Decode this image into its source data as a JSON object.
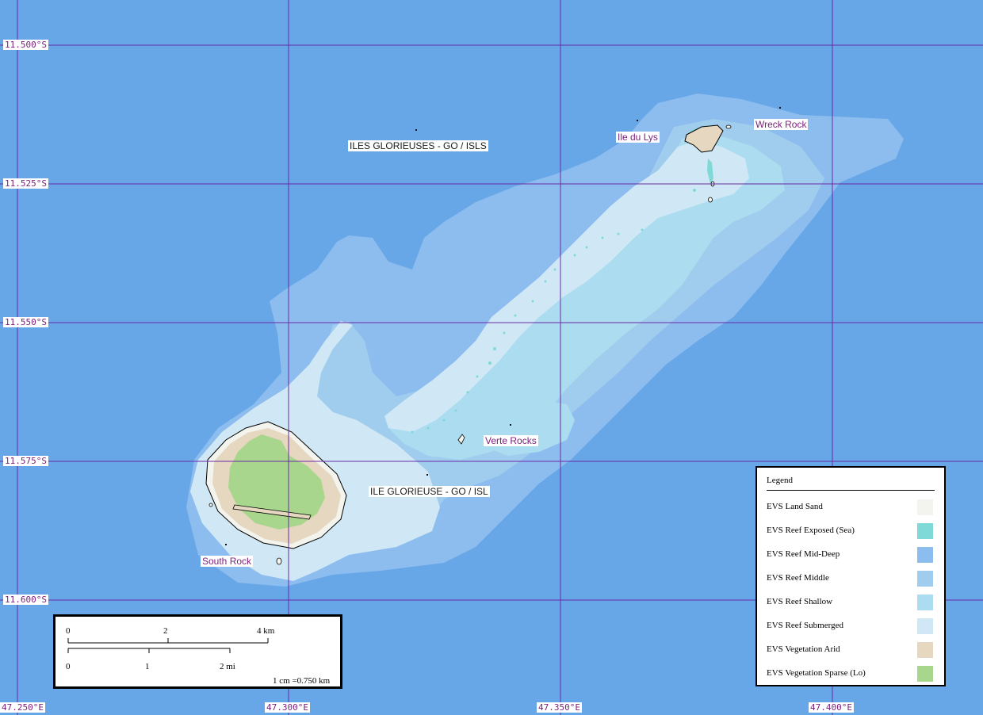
{
  "map": {
    "graticule": {
      "lat_labels": [
        "11.500°S",
        "11.525°S",
        "11.550°S",
        "11.575°S",
        "11.600°S"
      ],
      "lon_labels": [
        "47.250°E",
        "47.300°E",
        "47.350°E",
        "47.400°E"
      ]
    },
    "places": {
      "iles_glorieuses": "ILES GLORIEUSES - GO / ISLS",
      "ile_du_lys": "Ile du Lys",
      "wreck_rock": "Wreck Rock",
      "verte_rocks": "Verte Rocks",
      "ile_glorieuse": "ILE GLORIEUSE - GO / ISL",
      "south_rock": "South Rock"
    },
    "colors": {
      "sea": "#67a7e8",
      "grid": "#6a2aa8",
      "land_sand": "#f4f4ee",
      "reef_exposed": "#7fd9d6",
      "reef_mid_deep": "#8dbdee",
      "reef_middle": "#a0ccee",
      "reef_shallow": "#abdcf0",
      "reef_submerged": "#d0e8f5",
      "vegetation_arid": "#e6d7c1",
      "vegetation_sparse": "#a8d68c"
    }
  },
  "legend": {
    "title": "Legend",
    "items": [
      {
        "label": "EVS Land Sand",
        "color": "#f4f4ee"
      },
      {
        "label": "EVS Reef Exposed (Sea)",
        "color": "#7fd9d6"
      },
      {
        "label": "EVS Reef Mid-Deep",
        "color": "#8dbdee"
      },
      {
        "label": "EVS Reef Middle",
        "color": "#a0ccee"
      },
      {
        "label": "EVS Reef Shallow",
        "color": "#abdcf0"
      },
      {
        "label": "EVS Reef Submerged",
        "color": "#d0e8f5"
      },
      {
        "label": "EVS Vegetation Arid",
        "color": "#e6d7c1"
      },
      {
        "label": "EVS Vegetation Sparse (Lo)",
        "color": "#a8d68c"
      }
    ]
  },
  "scalebar": {
    "km_ticks": [
      "0",
      "2",
      "4 km"
    ],
    "mi_ticks": [
      "0",
      "1",
      "2 mi"
    ],
    "ratio": "1 cm =0.750 km"
  }
}
